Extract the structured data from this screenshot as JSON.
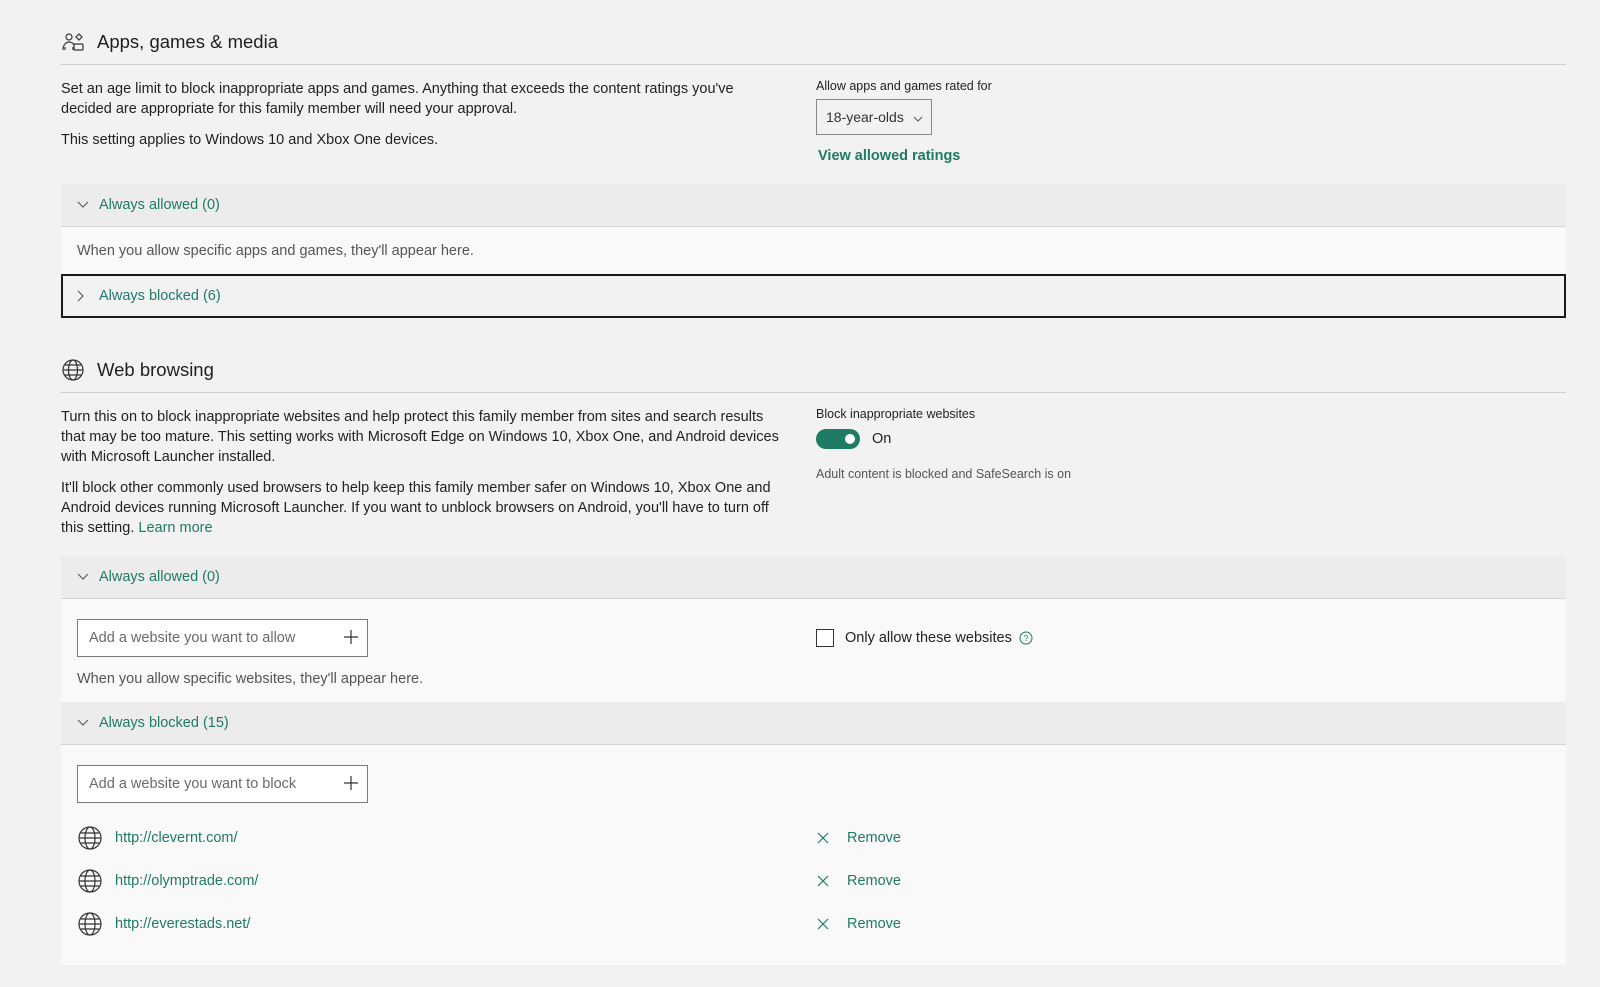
{
  "apps": {
    "title": "Apps, games & media",
    "desc1": "Set an age limit to block inappropriate apps and games. Anything that exceeds the content ratings you've decided are appropriate for this family member will need your approval.",
    "desc2": "This setting applies to Windows 10 and Xbox One devices.",
    "rating_label": "Allow apps and games rated for",
    "rating_value": "18-year-olds",
    "view_ratings": "View allowed ratings",
    "allowed_header": "Always allowed (0)",
    "allowed_empty": "When you allow specific apps and games, they'll appear here.",
    "blocked_header": "Always blocked (6)"
  },
  "web": {
    "title": "Web browsing",
    "desc1": "Turn this on to block inappropriate websites and help protect this family member from sites and search results that may be too mature. This setting works with Microsoft Edge on Windows 10, Xbox One, and Android devices with Microsoft Launcher installed.",
    "desc2": "It'll block other commonly used browsers to help keep this family member safer on Windows 10, Xbox One and Android devices running Microsoft Launcher. If you want to unblock browsers on Android, you'll have to turn off this setting.",
    "learn_more": "Learn more",
    "block_label": "Block inappropriate websites",
    "toggle_state": "On",
    "toggle_note": "Adult content is blocked and SafeSearch is on",
    "allowed_header": "Always allowed (0)",
    "allow_placeholder": "Add a website you want to allow",
    "only_allow_label": "Only allow these websites",
    "allowed_empty": "When you allow specific websites, they'll appear here.",
    "blocked_header": "Always blocked (15)",
    "block_placeholder": "Add a website you want to block",
    "blocked_sites": [
      {
        "url": "http://clevernt.com/",
        "action": "Remove"
      },
      {
        "url": "http://olymptrade.com/",
        "action": "Remove"
      },
      {
        "url": "http://everestads.net/",
        "action": "Remove"
      }
    ]
  },
  "colors": {
    "accent": "#1f7a66",
    "background": "#f2f2f2"
  }
}
